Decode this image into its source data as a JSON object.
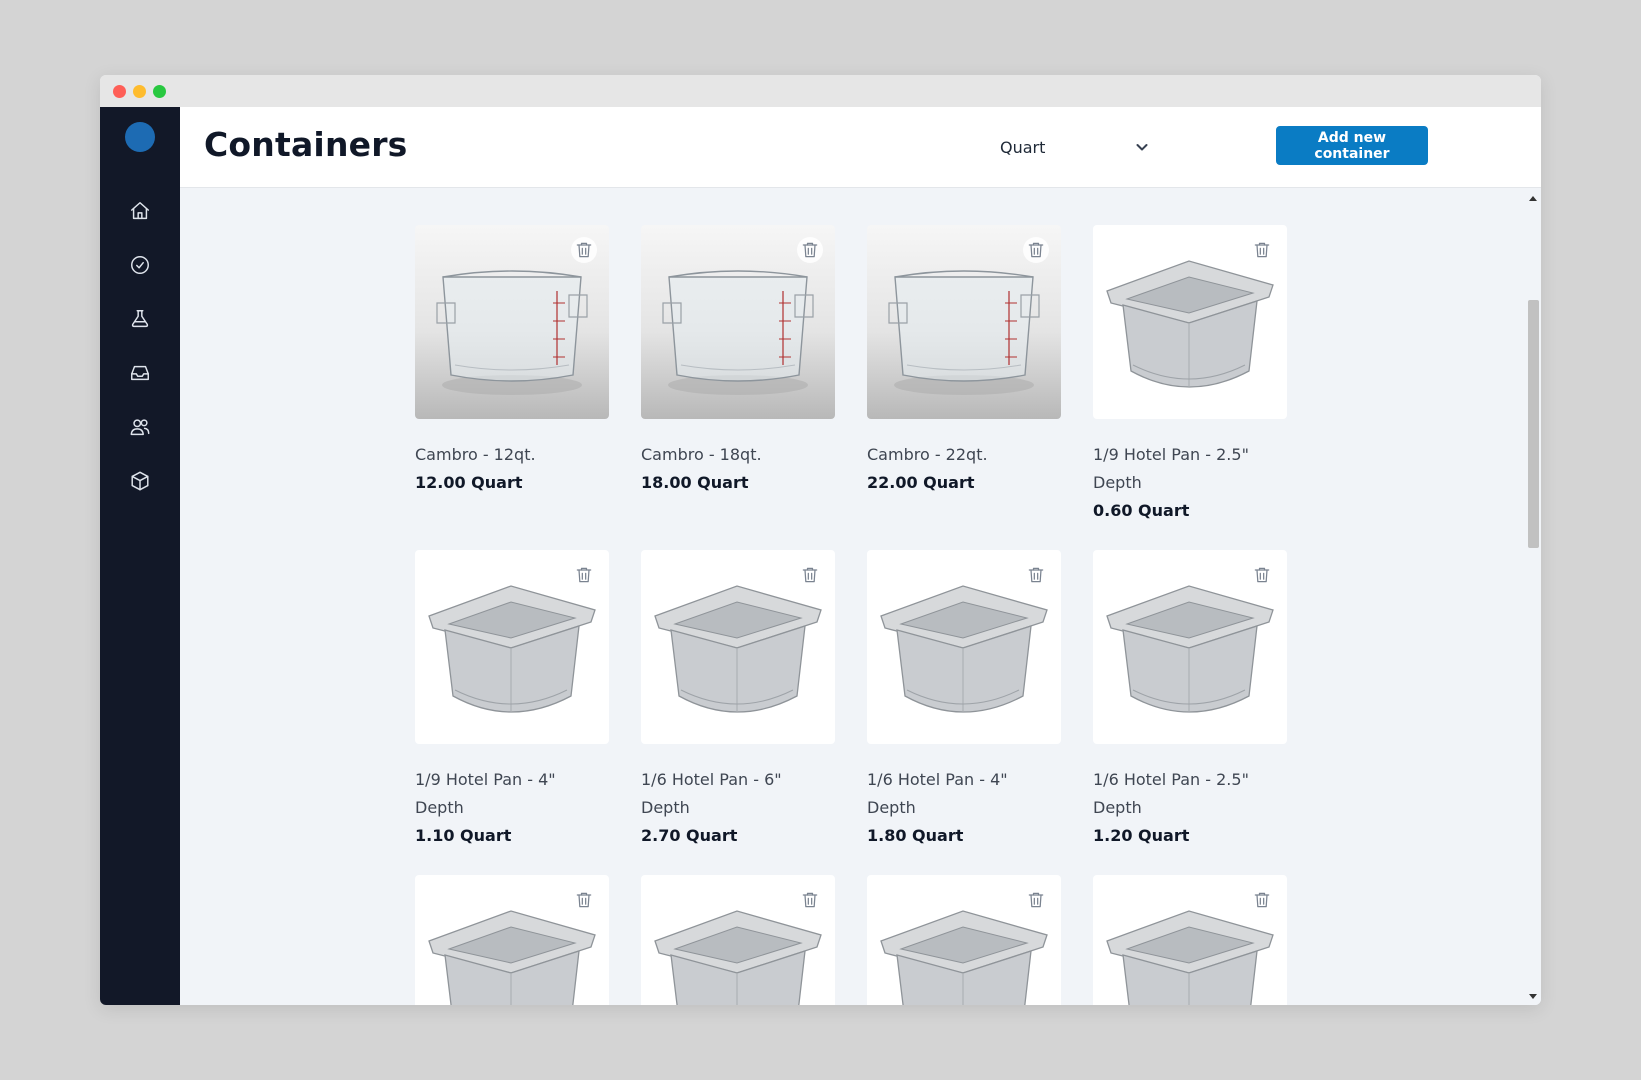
{
  "header": {
    "title": "Containers",
    "unit_selected": "Quart",
    "add_button_label": "Add new container"
  },
  "sidebar": {
    "items": [
      {
        "icon": "home-icon"
      },
      {
        "icon": "check-circle-icon"
      },
      {
        "icon": "flask-icon"
      },
      {
        "icon": "inbox-icon"
      },
      {
        "icon": "users-icon"
      },
      {
        "icon": "box-icon"
      }
    ]
  },
  "containers": [
    {
      "name": "Cambro - 12qt.",
      "volume": "12.00 Quart",
      "image": "cambro-square-container"
    },
    {
      "name": "Cambro - 18qt.",
      "volume": "18.00 Quart",
      "image": "cambro-square-container"
    },
    {
      "name": "Cambro - 22qt.",
      "volume": "22.00 Quart",
      "image": "cambro-square-container"
    },
    {
      "name": "1/9 Hotel Pan - 2.5\" Depth",
      "volume": "0.60 Quart",
      "image": "hotel-pan"
    },
    {
      "name": "1/9 Hotel Pan - 4\" Depth",
      "volume": "1.10 Quart",
      "image": "hotel-pan"
    },
    {
      "name": "1/6 Hotel Pan - 6\" Depth",
      "volume": "2.70 Quart",
      "image": "hotel-pan"
    },
    {
      "name": "1/6 Hotel Pan - 4\" Depth",
      "volume": "1.80 Quart",
      "image": "hotel-pan"
    },
    {
      "name": "1/6 Hotel Pan - 2.5\" Depth",
      "volume": "1.20 Quart",
      "image": "hotel-pan"
    },
    {
      "name": "",
      "volume": "",
      "image": "hotel-pan"
    },
    {
      "name": "",
      "volume": "",
      "image": "hotel-pan"
    },
    {
      "name": "",
      "volume": "",
      "image": "hotel-pan"
    },
    {
      "name": "",
      "volume": "",
      "image": "hotel-pan"
    }
  ],
  "colors": {
    "sidebar_bg": "#121828",
    "accent": "#0a7cc4",
    "content_bg": "#f1f4f8"
  }
}
